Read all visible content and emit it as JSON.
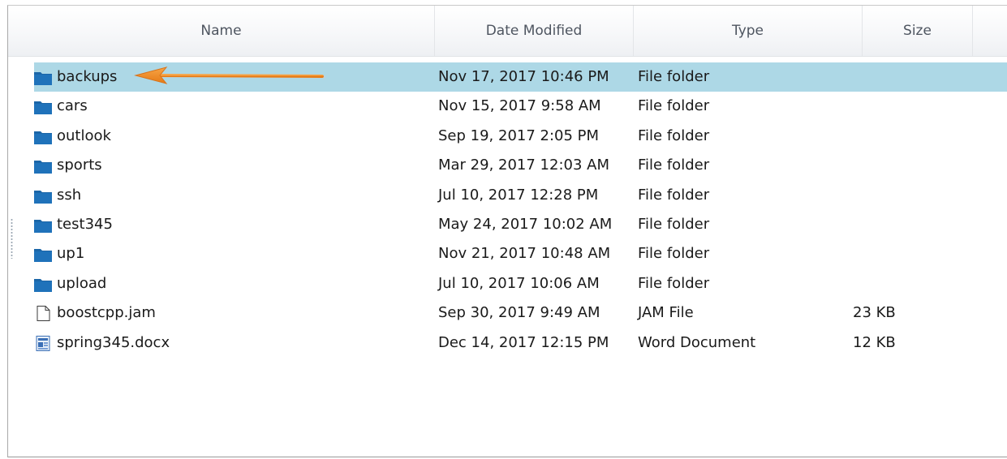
{
  "columns": {
    "name": "Name",
    "date": "Date Modified",
    "type": "Type",
    "size": "Size"
  },
  "rows": [
    {
      "name": "backups",
      "date": "Nov 17, 2017 10:46 PM",
      "type": "File folder",
      "size": "",
      "icon": "folder-icon",
      "selected": true
    },
    {
      "name": "cars",
      "date": "Nov 15, 2017 9:58 AM",
      "type": "File folder",
      "size": "",
      "icon": "folder-icon"
    },
    {
      "name": "outlook",
      "date": "Sep 19, 2017 2:05 PM",
      "type": "File folder",
      "size": "",
      "icon": "folder-icon"
    },
    {
      "name": "sports",
      "date": "Mar 29, 2017 12:03 AM",
      "type": "File folder",
      "size": "",
      "icon": "folder-icon"
    },
    {
      "name": "ssh",
      "date": "Jul 10, 2017 12:28 PM",
      "type": "File folder",
      "size": "",
      "icon": "folder-icon"
    },
    {
      "name": "test345",
      "date": "May 24, 2017 10:02 AM",
      "type": "File folder",
      "size": "",
      "icon": "folder-icon"
    },
    {
      "name": "up1",
      "date": "Nov 21, 2017 10:48 AM",
      "type": "File folder",
      "size": "",
      "icon": "folder-icon"
    },
    {
      "name": "upload",
      "date": "Jul 10, 2017 10:06 AM",
      "type": "File folder",
      "size": "",
      "icon": "folder-icon"
    },
    {
      "name": "boostcpp.jam",
      "date": "Sep 30, 2017 9:49 AM",
      "type": "JAM File",
      "size": "23 KB",
      "icon": "file-icon"
    },
    {
      "name": "spring345.docx",
      "date": "Dec 14, 2017 12:15 PM",
      "type": "Word Document",
      "size": "12 KB",
      "icon": "word-document-icon"
    }
  ],
  "colors": {
    "selection": "#add8e6",
    "folder": "#1b66a8",
    "arrow": "#f28c28"
  }
}
